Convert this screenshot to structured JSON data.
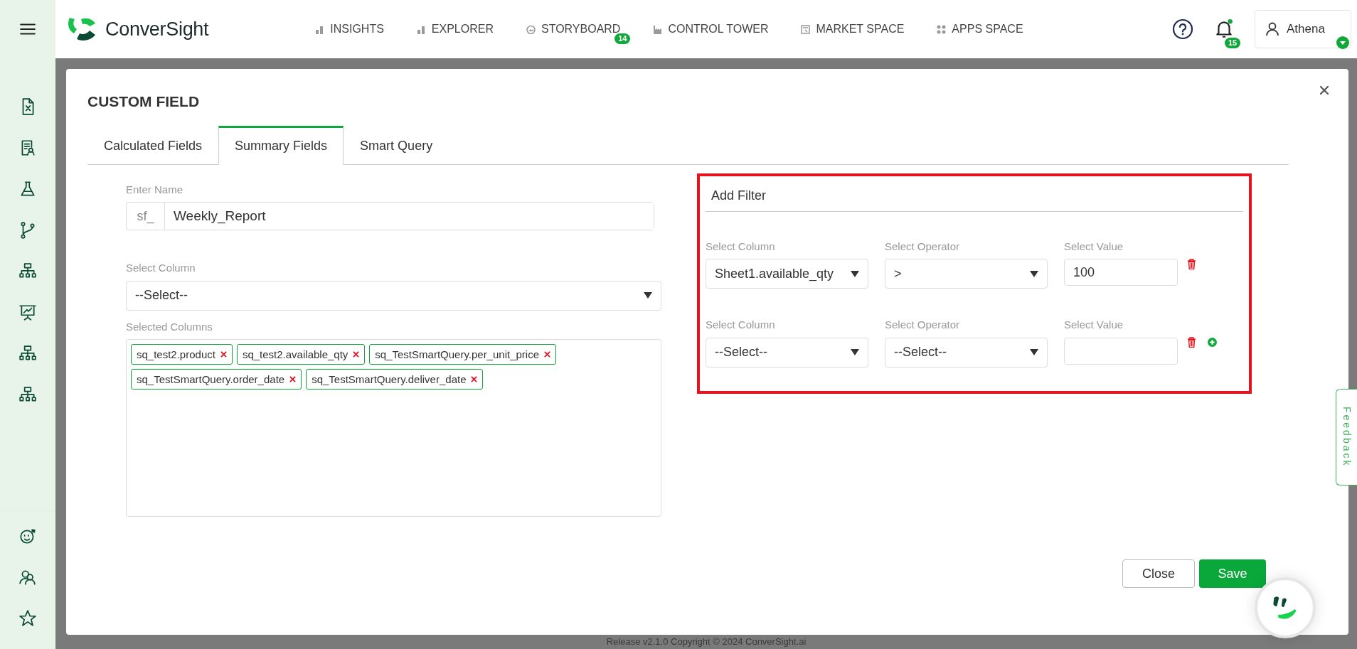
{
  "header": {
    "logo_text": "ConverSight",
    "nav": [
      {
        "label": "INSIGHTS"
      },
      {
        "label": "EXPLORER"
      },
      {
        "label": "STORYBOARD",
        "badge": "14"
      },
      {
        "label": "CONTROL TOWER"
      },
      {
        "label": "MARKET SPACE"
      },
      {
        "label": "APPS SPACE"
      }
    ],
    "notification_count": "15",
    "user_name": "Athena"
  },
  "modal": {
    "title": "CUSTOM FIELD",
    "tabs": [
      {
        "label": "Calculated Fields",
        "selected": false
      },
      {
        "label": "Summary Fields",
        "selected": true
      },
      {
        "label": "Smart Query",
        "selected": false
      }
    ],
    "name_field": {
      "label": "Enter Name",
      "prefix": "sf_",
      "value": "Weekly_Report"
    },
    "column_select": {
      "label": "Select Column",
      "value": "--Select--"
    },
    "selected_columns": {
      "label": "Selected Columns",
      "tags": [
        "sq_test2.product",
        "sq_test2.available_qty",
        "sq_TestSmartQuery.per_unit_price",
        "sq_TestSmartQuery.order_date",
        "sq_TestSmartQuery.deliver_date"
      ]
    },
    "filter": {
      "title": "Add Filter",
      "rows": [
        {
          "column_label": "Select Column",
          "column": "Sheet1.available_qty",
          "operator_label": "Select Operator",
          "operator": ">",
          "value_label": "Select Value",
          "value": "100",
          "show_add": false
        },
        {
          "column_label": "Select Column",
          "column": "--Select--",
          "operator_label": "Select Operator",
          "operator": "--Select--",
          "value_label": "Select Value",
          "show_add": true
        }
      ]
    },
    "buttons": {
      "close": "Close",
      "save": "Save"
    }
  },
  "footer": "Release v2.1.0 Copyright © 2024 ConverSight.ai",
  "feedback_label": "Feedback"
}
